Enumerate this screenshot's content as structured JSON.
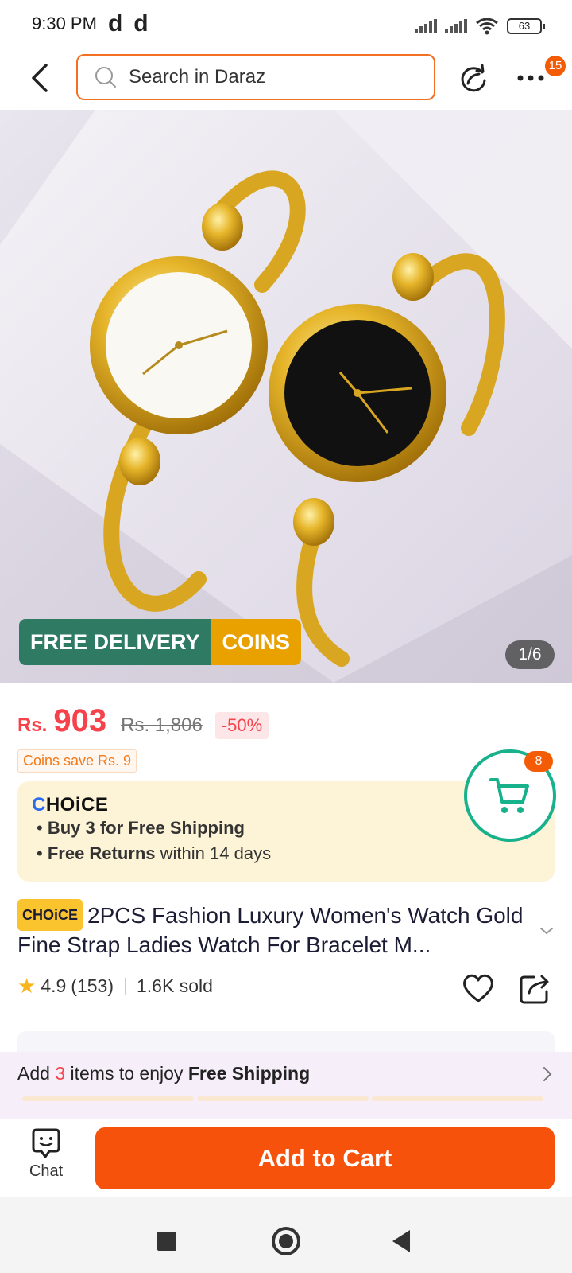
{
  "status_bar": {
    "time": "9:30 PM",
    "indicators": [
      "d",
      "d"
    ],
    "battery": "63"
  },
  "header": {
    "search_placeholder": "Search in Daraz",
    "more_badge": "15"
  },
  "gallery": {
    "promo_free": "FREE DELIVERY",
    "promo_coins": "COINS",
    "counter": "1/6",
    "current_index": 1,
    "total_images": 6
  },
  "price": {
    "currency": "Rs.",
    "current": "903",
    "original": "Rs. 1,806",
    "discount": "-50%",
    "coins_save": "Coins save Rs. 9"
  },
  "choice": {
    "logo_prefix": "C",
    "logo_rest": "HOiCE",
    "line1_bold": "Buy 3 for  Free Shipping",
    "line2_bold": "Free Returns",
    "line2_rest": " within 14 days",
    "cart_count": "8"
  },
  "product": {
    "tag": "CHOiCE",
    "title": "2PCS Fashion Luxury Women's Watch Gold Fine Strap Ladies Watch For Bracelet M...",
    "rating": "4.9",
    "reviews": "(153)",
    "sold": "1.6K sold"
  },
  "shipping_bar": {
    "prefix": "Add ",
    "count": "3",
    "middle": " items to enjoy ",
    "bold": "Free Shipping"
  },
  "action_bar": {
    "chat_label": "Chat",
    "add_to_cart": "Add to Cart"
  },
  "colors": {
    "brand_orange": "#f7520b",
    "price_red": "#f5424b",
    "choice_yellow": "#f9c42d",
    "cart_teal": "#17b28c",
    "delivery_green": "#2f7a63",
    "coins_gold": "#e9a100"
  }
}
